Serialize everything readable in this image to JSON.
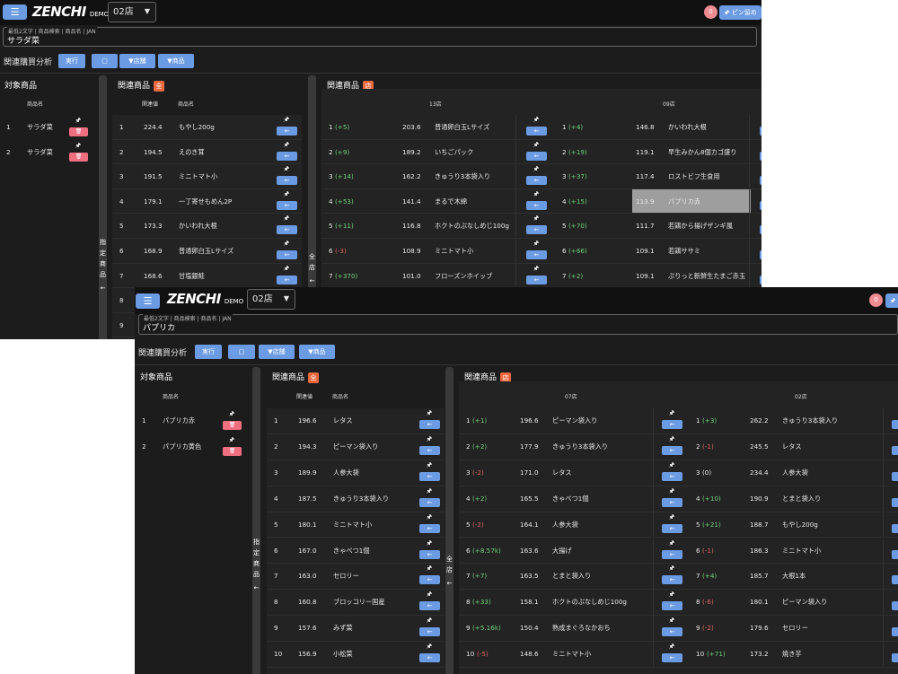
{
  "window1": {
    "logo": "ZENCHI",
    "logo_sub": "DEMO",
    "store_select": "02店",
    "badge_count": "0",
    "pin_label": "ピン留め",
    "search_placeholder": "最低2文字 | 商品検索 | 商品名 | JAN",
    "search_value": "サラダ菜",
    "toolbar_label": "関連購買分析",
    "run_label": "実行",
    "filter_store_label": "店舗",
    "filter_product_label": "商品",
    "target_title": "対象商品",
    "target_col_name": "商品名",
    "targets": [
      {
        "no": "1",
        "name": "サラダ菜"
      },
      {
        "no": "2",
        "name": "サラダ菜"
      }
    ],
    "side_text": [
      "指",
      "定",
      "商",
      "品"
    ],
    "related_title": "関連商品",
    "related_chip": "全",
    "related_col_value": "関連値",
    "related_col_name": "商品名",
    "related": [
      {
        "no": "1",
        "value": "224.4",
        "name": "もやし200g"
      },
      {
        "no": "2",
        "value": "194.5",
        "name": "えのき茸"
      },
      {
        "no": "3",
        "value": "191.5",
        "name": "ミニトマト小"
      },
      {
        "no": "4",
        "value": "179.1",
        "name": "一丁寄せもめん2P"
      },
      {
        "no": "5",
        "value": "173.3",
        "name": "かいわれ大根"
      },
      {
        "no": "6",
        "value": "168.9",
        "name": "普通卵白玉Lサイズ"
      },
      {
        "no": "7",
        "value": "168.6",
        "name": "甘塩銀鮭"
      },
      {
        "no": "8",
        "value": "",
        "name": ""
      },
      {
        "no": "9",
        "value": "",
        "name": ""
      }
    ],
    "all_store_side": [
      "全",
      "店"
    ],
    "store_title": "関連商品",
    "store_chip": "店",
    "stores": [
      {
        "name": "13店",
        "rows": [
          {
            "rank": "1",
            "delta": "(+5)",
            "dir": "g",
            "value": "203.6",
            "name": "普通卵白玉Lサイズ"
          },
          {
            "rank": "2",
            "delta": "(+9)",
            "dir": "g",
            "value": "189.2",
            "name": "いちごパック"
          },
          {
            "rank": "3",
            "delta": "(+14)",
            "dir": "g",
            "value": "162.2",
            "name": "きゅうり3本袋入り"
          },
          {
            "rank": "4",
            "delta": "(+53)",
            "dir": "g",
            "value": "141.4",
            "name": "まるで木綿"
          },
          {
            "rank": "5",
            "delta": "(+11)",
            "dir": "g",
            "value": "116.8",
            "name": "ホクトのぶなしめじ100g"
          },
          {
            "rank": "6",
            "delta": "(-3)",
            "dir": "r",
            "value": "108.9",
            "name": "ミニトマト小"
          },
          {
            "rank": "7",
            "delta": "(+370)",
            "dir": "g",
            "value": "101.0",
            "name": "フローズンホイップ"
          }
        ]
      },
      {
        "name": "09店",
        "rows": [
          {
            "rank": "1",
            "delta": "(+4)",
            "dir": "g",
            "value": "146.8",
            "name": "かいわれ大根"
          },
          {
            "rank": "2",
            "delta": "(+19)",
            "dir": "g",
            "value": "119.1",
            "name": "早生みかん8個カゴ盛り"
          },
          {
            "rank": "3",
            "delta": "(+37)",
            "dir": "g",
            "value": "117.4",
            "name": "ロストビフ生食用"
          },
          {
            "rank": "4",
            "delta": "(+15)",
            "dir": "g",
            "value": "113.9",
            "name": "パプリカ赤",
            "highlight": true
          },
          {
            "rank": "5",
            "delta": "(+70)",
            "dir": "g",
            "value": "111.7",
            "name": "若鶏から揚げザンギ風"
          },
          {
            "rank": "6",
            "delta": "(+66)",
            "dir": "g",
            "value": "109.1",
            "name": "若鶏ササミ"
          },
          {
            "rank": "7",
            "delta": "(+2)",
            "dir": "g",
            "value": "109.1",
            "name": "ぷりっと新鮮生たまご赤玉"
          }
        ]
      }
    ]
  },
  "window2": {
    "logo": "ZENCHI",
    "logo_sub": "DEMO",
    "store_select": "02店",
    "badge_count": "0",
    "search_placeholder": "最低2文字 | 商品検索 | 商品名 | JAN",
    "search_value": "パプリカ",
    "toolbar_label": "関連購買分析",
    "run_label": "実行",
    "filter_store_label": "店舗",
    "filter_product_label": "商品",
    "target_title": "対象商品",
    "target_col_name": "商品名",
    "targets": [
      {
        "no": "1",
        "name": "パプリカ赤"
      },
      {
        "no": "2",
        "name": "パプリカ黄色"
      }
    ],
    "side_text": [
      "指",
      "定",
      "商",
      "品"
    ],
    "related_title": "関連商品",
    "related_chip": "全",
    "related_col_value": "関連値",
    "related_col_name": "商品名",
    "related": [
      {
        "no": "1",
        "value": "196.6",
        "name": "レタス"
      },
      {
        "no": "2",
        "value": "194.3",
        "name": "ピーマン袋入り"
      },
      {
        "no": "3",
        "value": "189.9",
        "name": "人参大袋"
      },
      {
        "no": "4",
        "value": "187.5",
        "name": "きゅうり3本袋入り"
      },
      {
        "no": "5",
        "value": "180.1",
        "name": "ミニトマト小"
      },
      {
        "no": "6",
        "value": "167.0",
        "name": "きゃべつ1個"
      },
      {
        "no": "7",
        "value": "163.0",
        "name": "セロリー"
      },
      {
        "no": "8",
        "value": "160.8",
        "name": "ブロッコリー国産"
      },
      {
        "no": "9",
        "value": "157.6",
        "name": "みず菜"
      },
      {
        "no": "10",
        "value": "156.9",
        "name": "小松菜"
      }
    ],
    "all_store_side": [
      "全",
      "店"
    ],
    "store_title": "関連商品",
    "store_chip": "店",
    "stores": [
      {
        "name": "07店",
        "rows": [
          {
            "rank": "1",
            "delta": "(+1)",
            "dir": "g",
            "value": "196.6",
            "name": "ピーマン袋入り"
          },
          {
            "rank": "2",
            "delta": "(+2)",
            "dir": "g",
            "value": "177.9",
            "name": "きゅうり3本袋入り"
          },
          {
            "rank": "3",
            "delta": "(-2)",
            "dir": "r",
            "value": "171.0",
            "name": "レタス"
          },
          {
            "rank": "4",
            "delta": "(+2)",
            "dir": "g",
            "value": "165.5",
            "name": "きゃべつ1個"
          },
          {
            "rank": "5",
            "delta": "(-2)",
            "dir": "r",
            "value": "164.1",
            "name": "人参大袋"
          },
          {
            "rank": "6",
            "delta": "(+8.57k)",
            "dir": "g",
            "value": "163.6",
            "name": "大揚げ"
          },
          {
            "rank": "7",
            "delta": "(+7)",
            "dir": "g",
            "value": "163.5",
            "name": "とまと袋入り"
          },
          {
            "rank": "8",
            "delta": "(+33)",
            "dir": "g",
            "value": "158.1",
            "name": "ホクトのぶなしめじ100g"
          },
          {
            "rank": "9",
            "delta": "(+5.16k)",
            "dir": "g",
            "value": "150.4",
            "name": "熟成まぐろなかおち"
          },
          {
            "rank": "10",
            "delta": "(-5)",
            "dir": "r",
            "value": "148.6",
            "name": "ミニトマト小"
          }
        ]
      },
      {
        "name": "02店",
        "rows": [
          {
            "rank": "1",
            "delta": "(+3)",
            "dir": "g",
            "value": "262.2",
            "name": "きゅうり3本袋入り"
          },
          {
            "rank": "2",
            "delta": "(-1)",
            "dir": "r",
            "value": "245.5",
            "name": "レタス"
          },
          {
            "rank": "3",
            "delta": "(0)",
            "dir": "n",
            "value": "234.4",
            "name": "人参大袋"
          },
          {
            "rank": "4",
            "delta": "(+10)",
            "dir": "g",
            "value": "190.9",
            "name": "とまと袋入り"
          },
          {
            "rank": "5",
            "delta": "(+21)",
            "dir": "g",
            "value": "188.7",
            "name": "もやし200g"
          },
          {
            "rank": "6",
            "delta": "(-1)",
            "dir": "r",
            "value": "186.3",
            "name": "ミニトマト小"
          },
          {
            "rank": "7",
            "delta": "(+4)",
            "dir": "g",
            "value": "185.7",
            "name": "大根1本"
          },
          {
            "rank": "8",
            "delta": "(-6)",
            "dir": "r",
            "value": "180.1",
            "name": "ピーマン袋入り"
          },
          {
            "rank": "9",
            "delta": "(-2)",
            "dir": "r",
            "value": "179.6",
            "name": "セロリー"
          },
          {
            "rank": "10",
            "delta": "(+71)",
            "dir": "g",
            "value": "173.2",
            "name": "焼き芋"
          }
        ]
      }
    ]
  },
  "icons": {
    "menu": "≡",
    "pin": "🖈",
    "arrow": "←",
    "trash": "🗑",
    "filter": "⏷",
    "caret": "▼",
    "square": "◻"
  }
}
